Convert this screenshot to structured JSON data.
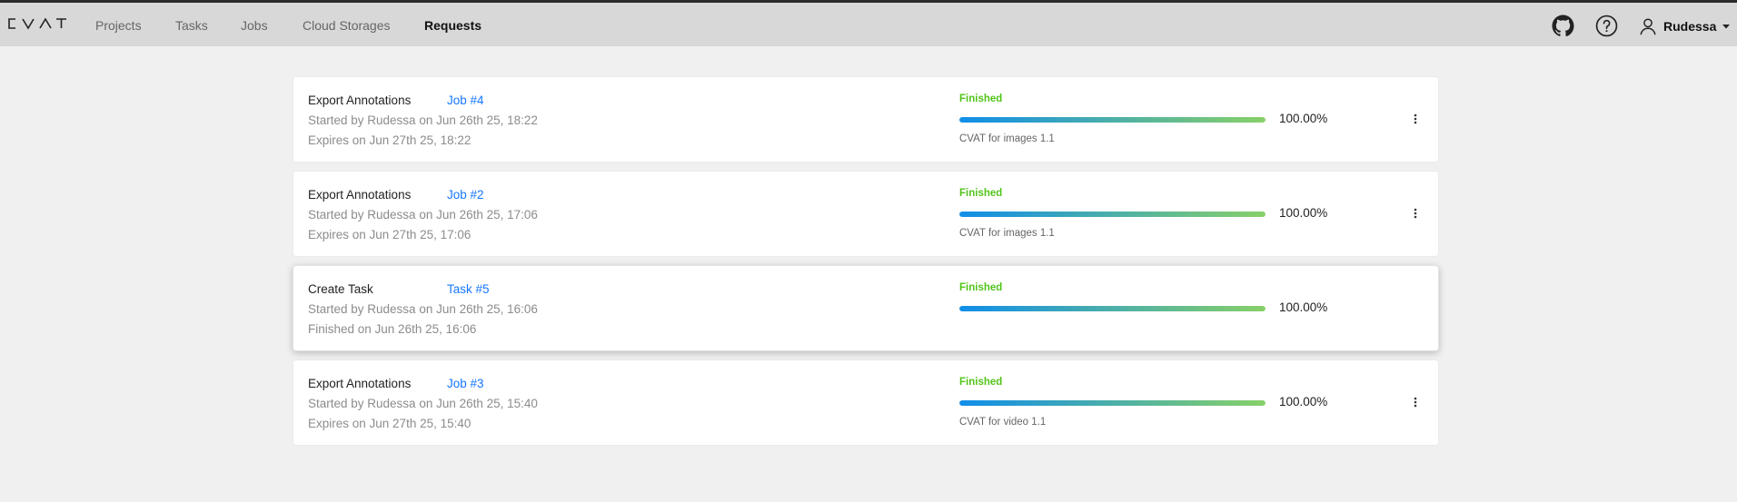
{
  "header": {
    "logo": "CVAT",
    "nav": {
      "projects": "Projects",
      "tasks": "Tasks",
      "jobs": "Jobs",
      "cloud_storages": "Cloud Storages",
      "requests": "Requests"
    },
    "icons": {
      "github": "github-icon",
      "help": "question-circle-icon",
      "user": "user-icon",
      "caret": "caret-down-icon"
    },
    "user_name": "Rudessa"
  },
  "colors": {
    "status_finished": "#52c41a",
    "link": "#1677ff",
    "progress_from": "#108ee9",
    "progress_to": "#87d068"
  },
  "requests": [
    {
      "title": "Export Annotations",
      "link": "Job #4",
      "started": "Started by Rudessa on Jun 26th 25, 18:22",
      "expires": "Expires on Jun 27th 25, 18:22",
      "status": "Finished",
      "progress_fraction": 1.0,
      "progress_label": "100.00%",
      "format": "CVAT for images 1.1",
      "has_menu": true
    },
    {
      "title": "Export Annotations",
      "link": "Job #2",
      "started": "Started by Rudessa on Jun 26th 25, 17:06",
      "expires": "Expires on Jun 27th 25, 17:06",
      "status": "Finished",
      "progress_fraction": 1.0,
      "progress_label": "100.00%",
      "format": "CVAT for images 1.1",
      "has_menu": true
    },
    {
      "title": "Create Task",
      "link": "Task #5",
      "started": "Started by Rudessa on Jun 26th 25, 16:06",
      "expires": "Finished on Jun 26th 25, 16:06",
      "status": "Finished",
      "progress_fraction": 1.0,
      "progress_label": "100.00%",
      "format": "",
      "has_menu": false
    },
    {
      "title": "Export Annotations",
      "link": "Job #3",
      "started": "Started by Rudessa on Jun 26th 25, 15:40",
      "expires": "Expires on Jun 27th 25, 15:40",
      "status": "Finished",
      "progress_fraction": 1.0,
      "progress_label": "100.00%",
      "format": "CVAT for video 1.1",
      "has_menu": true
    }
  ]
}
